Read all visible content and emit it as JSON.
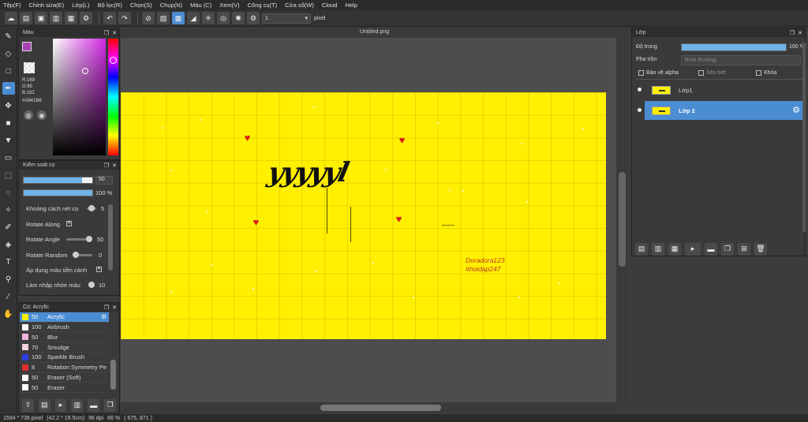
{
  "menu": [
    "Tệp(F)",
    "Chỉnh sửa(E)",
    "Lớp(L)",
    "Bộ lọc(R)",
    "Chọn(S)",
    "Chụp(N)",
    "Màu (C)",
    "Xem(V)",
    "Công cụ(T)",
    "Cửa sổ(W)",
    "Cloud",
    "Help"
  ],
  "toolbar": {
    "brush_size_value": "1",
    "size_unit": "pixel"
  },
  "color_panel": {
    "title": "Màu",
    "r": "R:169",
    "g": "G:65",
    "b": "B:182",
    "hex": "#A941B6",
    "primary_color": "#a941b6",
    "secondary_color": "#cc2f6e"
  },
  "brush_control": {
    "title": "Kiểm soát cọ",
    "size_value": "50",
    "size_fraction": 0.85,
    "opacity_value": "100 %",
    "opacity_fraction": 1.0,
    "rows": [
      {
        "label": "Khoảng cách nét cọ",
        "value": "5"
      },
      {
        "label": "Rotate Along",
        "value": ""
      },
      {
        "label": "Rotate Angle",
        "value": "50"
      },
      {
        "label": "Rotate Random",
        "value": "0"
      },
      {
        "label": "Áp dụng màu tiền cảnh",
        "value": ""
      },
      {
        "label": "Làm nhập nhòe màu",
        "value": "10"
      }
    ]
  },
  "brush_list": {
    "title": "Cọ: Acrylic",
    "items": [
      {
        "size": "50",
        "name": "Acrylic",
        "color": "#ffef00",
        "selected": true
      },
      {
        "size": "100",
        "name": "Airbrush",
        "color": "#ffffff"
      },
      {
        "size": "50",
        "name": "Blur",
        "color": "#f2b4e0"
      },
      {
        "size": "70",
        "name": "Smudge",
        "color": "#f5d0e0"
      },
      {
        "size": "100",
        "name": "Sparkle Brush",
        "color": "#2f3ee0"
      },
      {
        "size": "8",
        "name": "Rotation Symmetry Pe",
        "color": "#e02f2f"
      },
      {
        "size": "50",
        "name": "Eraser (Soft)",
        "color": "#ffffff"
      },
      {
        "size": "50",
        "name": "Eraser",
        "color": "#ffffff"
      }
    ]
  },
  "document": {
    "title": "Untitled.png",
    "handwriting": "yyyyyl",
    "watermark_line1": "Doradora123",
    "watermark_line2": "#hoidap247",
    "canvas_color": "#ffef00"
  },
  "layers": {
    "title": "Lớp",
    "opacity_label": "Độ trong",
    "opacity_value": "100 %",
    "opacity_fraction": 1.0,
    "blend_label": "Pha trộn",
    "blend_value": "Bình thường",
    "protect_alpha": "Bảo vệ alpha",
    "clipping": "Xén bớt",
    "lock": "Khóa",
    "items": [
      {
        "name": "Lớp1",
        "selected": false
      },
      {
        "name": "Lớp 2",
        "selected": true
      }
    ]
  },
  "status": {
    "size": "1594 * 736 pixel",
    "physical": "(42.2 * 19.5cm)",
    "dpi": "96 dpi",
    "zoom": "66 %",
    "cursor": "( 675, 871 )"
  },
  "accent_color": "#4b8dd3"
}
